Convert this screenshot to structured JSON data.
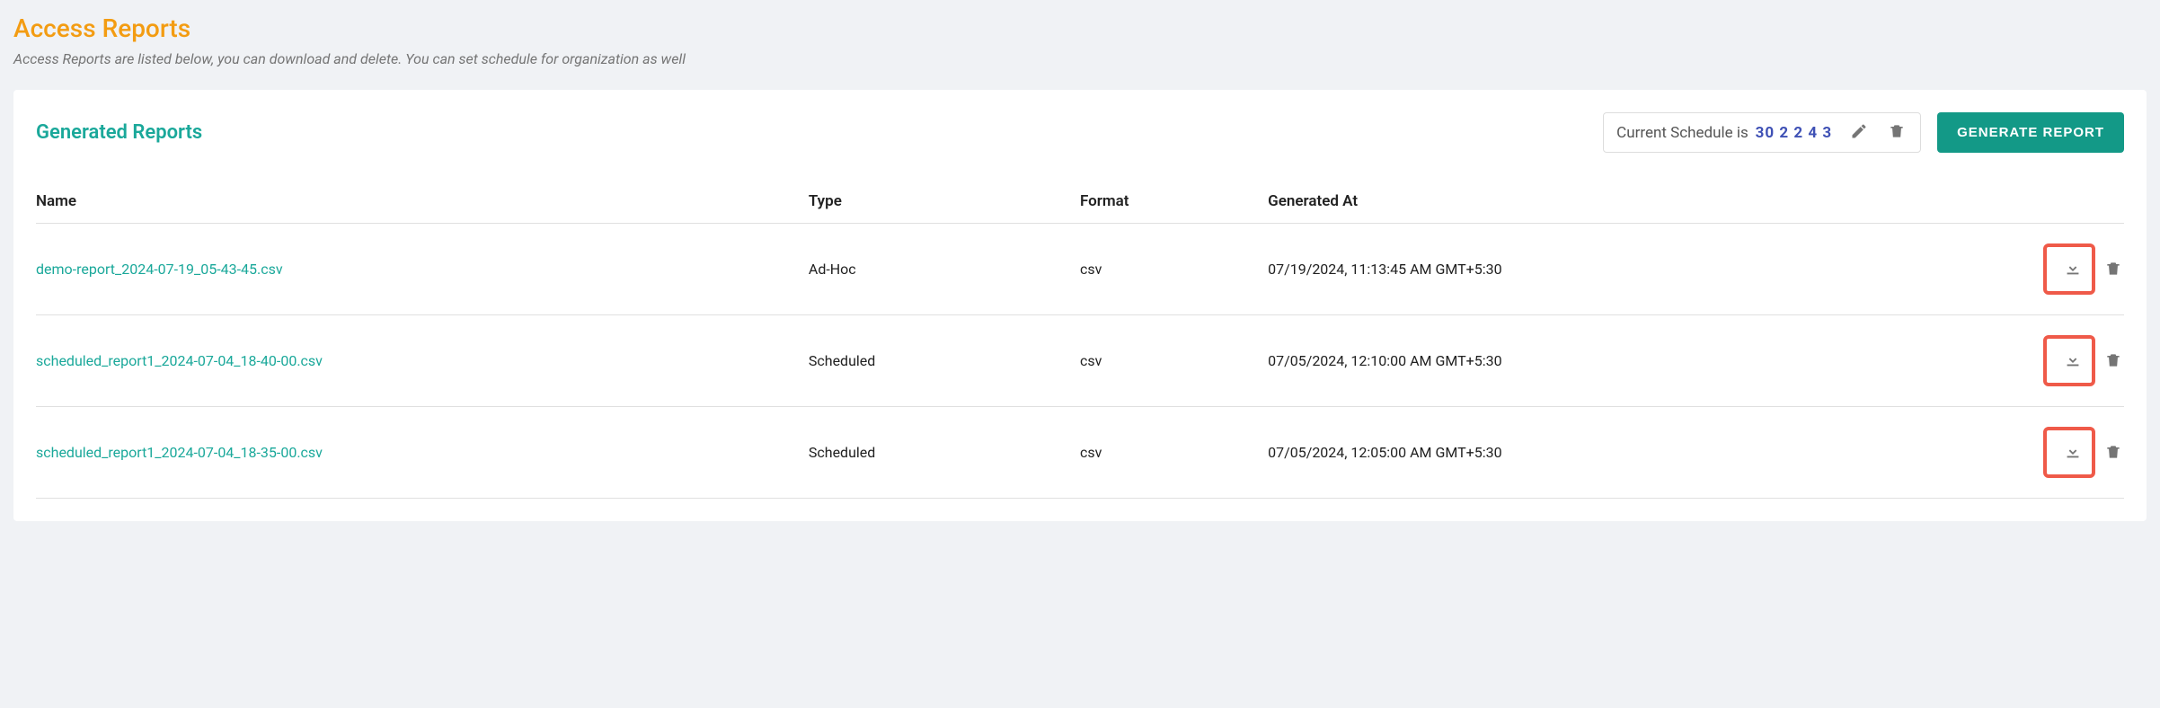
{
  "page": {
    "title": "Access Reports",
    "subtitle": "Access Reports are listed below, you can download and delete. You can set schedule for organization as well"
  },
  "card": {
    "title": "Generated Reports",
    "schedule_label": "Current Schedule is",
    "schedule_value": "30 2 2 4 3",
    "generate_button": "GENERATE REPORT"
  },
  "table": {
    "headers": {
      "name": "Name",
      "type": "Type",
      "format": "Format",
      "generated_at": "Generated At"
    },
    "rows": [
      {
        "name": "demo-report_2024-07-19_05-43-45.csv",
        "type": "Ad-Hoc",
        "format": "csv",
        "generated_at": "07/19/2024, 11:13:45 AM GMT+5:30"
      },
      {
        "name": "scheduled_report1_2024-07-04_18-40-00.csv",
        "type": "Scheduled",
        "format": "csv",
        "generated_at": "07/05/2024, 12:10:00 AM GMT+5:30"
      },
      {
        "name": "scheduled_report1_2024-07-04_18-35-00.csv",
        "type": "Scheduled",
        "format": "csv",
        "generated_at": "07/05/2024, 12:05:00 AM GMT+5:30"
      }
    ]
  }
}
